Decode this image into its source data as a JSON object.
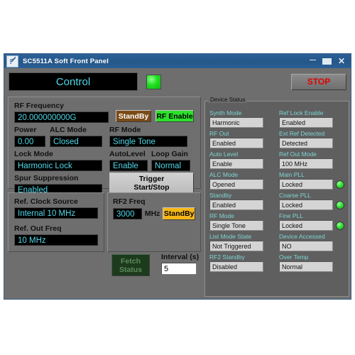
{
  "window": {
    "title": "SC5511A Soft Front Panel",
    "icon": "signal-icon",
    "minimize": "minimize-icon",
    "maximize": "maximize-icon",
    "close": "✕"
  },
  "header": {
    "control_label": "Control",
    "led": "power-led",
    "stop_label": "STOP"
  },
  "main_panel": {
    "rf_frequency": {
      "label": "RF Frequency",
      "value": "20.000000000G"
    },
    "power": {
      "label": "Power",
      "value": "0.00"
    },
    "alc_mode": {
      "label": "ALC Mode",
      "value": "Closed"
    },
    "lock_mode": {
      "label": "Lock Mode",
      "value": "Harmonic Lock"
    },
    "spur_suppression": {
      "label": "Spur Suppression",
      "value": "Enabled"
    },
    "standby_button": "StandBy",
    "rf_enable_button": "RF Enable",
    "rf_mode": {
      "label": "RF Mode",
      "value": "Single Tone"
    },
    "autolevel": {
      "label": "AutoLevel",
      "value": "Enable"
    },
    "loop_gain": {
      "label": "Loop Gain",
      "value": "Normal"
    },
    "trigger_button_line1": "Trigger",
    "trigger_button_line2": "Start/Stop"
  },
  "clock_panel": {
    "ref_clock_source": {
      "label": "Ref. Clock Source",
      "value": "Internal 10 MHz"
    },
    "ref_out_freq": {
      "label": "Ref. Out Freq",
      "value": "10 MHz"
    }
  },
  "rf2_panel": {
    "rf2_freq": {
      "label": "RF2 Freq",
      "value": "3000",
      "unit": "MHz"
    },
    "rf2_standby_button": "StandBy",
    "fetch_button_line1": "Fetch",
    "fetch_button_line2": "Status",
    "interval": {
      "label": "Interval (s)",
      "value": "5"
    }
  },
  "device_status": {
    "legend": "Device Status",
    "left_column": [
      {
        "label": "Synth Mode",
        "value": "Harmonic",
        "led": false
      },
      {
        "label": "RF Out",
        "value": "Enabled",
        "led": false
      },
      {
        "label": "Auto Level",
        "value": "Enable",
        "led": false
      },
      {
        "label": "ALC Mode",
        "value": "Opened",
        "led": false
      },
      {
        "label": "Standby",
        "value": "Enabled",
        "led": false
      },
      {
        "label": "RF Mode",
        "value": "Single Tone",
        "led": false
      },
      {
        "label": "List Mode State",
        "value": "Not Triggered",
        "led": false
      },
      {
        "label": "RF2 Standby",
        "value": "Disabled",
        "led": false
      }
    ],
    "right_column": [
      {
        "label": "Ref Lock Enable",
        "value": "Enabled",
        "led": false
      },
      {
        "label": "Ext Ref Detected",
        "value": "Detected",
        "led": false
      },
      {
        "label": "Ref Out Mode",
        "value": "100 MHz",
        "led": false
      },
      {
        "label": "Main PLL",
        "value": "Locked",
        "led": true
      },
      {
        "label": "Coarse PLL",
        "value": "Locked",
        "led": true
      },
      {
        "label": "Fine PLL",
        "value": "Locked",
        "led": true
      },
      {
        "label": "Device Accessed",
        "value": "NO",
        "led": false
      },
      {
        "label": "Over Temp",
        "value": "Normal",
        "led": false
      }
    ]
  },
  "colors": {
    "lcd_text": "#4fd8e8",
    "led_green": "#2ae22a",
    "stop_red": "#e00000",
    "standby_brown": "#7a4a16",
    "rf2_amber": "#f5b717",
    "status_label": "#7fd4d4"
  }
}
